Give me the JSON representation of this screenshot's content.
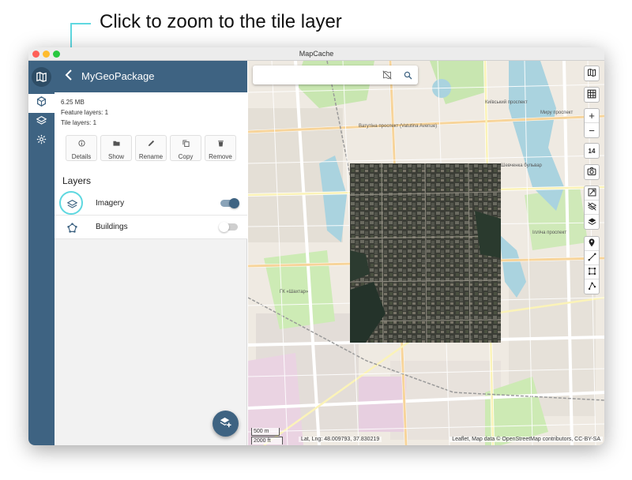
{
  "annotation": {
    "text": "Click to zoom to the tile layer"
  },
  "window": {
    "title": "MapCache"
  },
  "sidebar": {
    "title": "MyGeoPackage",
    "info": {
      "size": "6.25 MB",
      "feature_layers": "Feature layers: 1",
      "tile_layers": "Tile layers: 1"
    },
    "actions": [
      {
        "label": "Details",
        "icon": "info-icon"
      },
      {
        "label": "Show",
        "icon": "folder-icon"
      },
      {
        "label": "Rename",
        "icon": "pencil-icon"
      },
      {
        "label": "Copy",
        "icon": "copy-icon"
      },
      {
        "label": "Remove",
        "icon": "trash-icon"
      }
    ],
    "layers_heading": "Layers",
    "layers": [
      {
        "name": "Imagery",
        "icon": "tile-layers-icon",
        "enabled": true
      },
      {
        "name": "Buildings",
        "icon": "feature-polygon-icon",
        "enabled": false
      }
    ]
  },
  "map": {
    "zoom_level": "14",
    "scale_metric": "500 m",
    "scale_imperial": "2000 ft",
    "coordinates": "Lat, Lng: 48.009793, 37.830219",
    "attribution": "Leaflet, Map data © OpenStreetMap contributors, CC-BY-SA",
    "street_labels": {
      "vatutina": "Ватутіна проспект (Vatutina Avenue)",
      "myru": "Миру проспект",
      "shevchenko": "Шевченка бульвар",
      "illicha": "Ілліча проспект",
      "shakhtar": "ГК «Шахтар»",
      "kyivskyi": "Київський проспект"
    }
  },
  "colors": {
    "primary": "#3e6382",
    "accent": "#5fd8e0",
    "water": "#aad3df",
    "park": "#c8e6b0"
  }
}
